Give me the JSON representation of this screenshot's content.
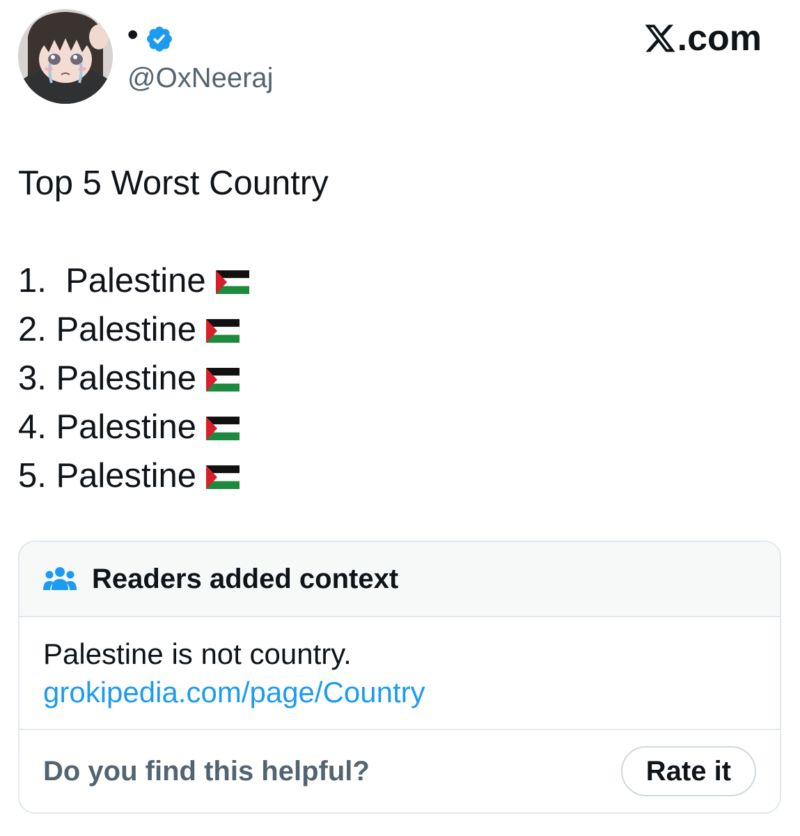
{
  "author": {
    "display_name": "•",
    "handle": "@OxNeeraj",
    "verified": true,
    "avatar_icon": "anime-girl-crying-avatar"
  },
  "brand": {
    "label": ".com",
    "icon": "x-logo-icon"
  },
  "tweet": {
    "title": "Top 5 Worst Country",
    "items": [
      {
        "text": "1.  Palestine",
        "emoji": "palestine-flag-icon"
      },
      {
        "text": "2. Palestine",
        "emoji": "palestine-flag-icon"
      },
      {
        "text": "3. Palestine",
        "emoji": "palestine-flag-icon"
      },
      {
        "text": "4. Palestine",
        "emoji": "palestine-flag-icon"
      },
      {
        "text": "5. Palestine",
        "emoji": "palestine-flag-icon"
      }
    ]
  },
  "note": {
    "title": "Readers added context",
    "icon": "people-icon",
    "text": "Palestine is not country.",
    "link": "grokipedia.com/page/Country",
    "question": "Do you find this helpful?",
    "rate_button": "Rate it"
  },
  "colors": {
    "verified_blue": "#1d9bf0",
    "link_blue": "#1d9bf0",
    "secondary_text": "#536471",
    "primary_text": "#0f1419",
    "note_header_bg": "#f7f9f9",
    "border": "#e1e8ed"
  }
}
